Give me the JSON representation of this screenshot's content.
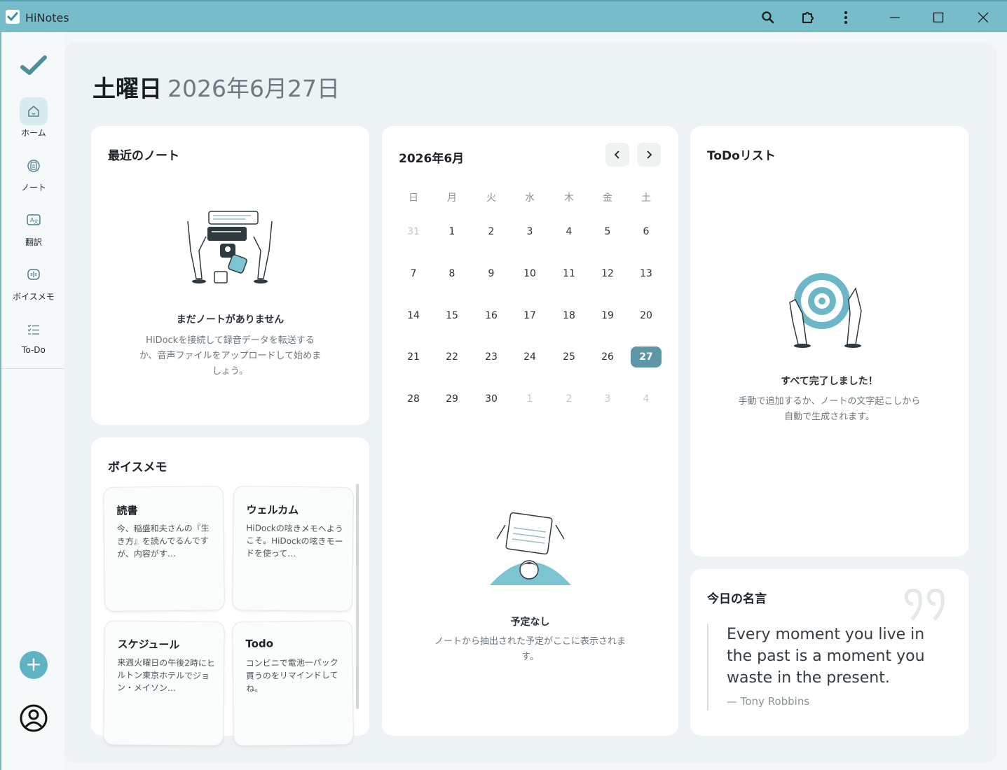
{
  "window": {
    "title": "HiNotes",
    "icons": [
      "search-icon",
      "extension-icon",
      "more-vertical-icon",
      "minimize-icon",
      "maximize-icon",
      "close-icon"
    ]
  },
  "sidebar": {
    "items": [
      {
        "label": "ホーム",
        "icon": "home-icon"
      },
      {
        "label": "ノート",
        "icon": "notes-icon"
      },
      {
        "label": "翻訳",
        "icon": "translate-icon"
      },
      {
        "label": "ボイスメモ",
        "icon": "voice-memo-icon"
      },
      {
        "label": "To-Do",
        "icon": "todo-list-icon"
      }
    ],
    "add_label": "+"
  },
  "header": {
    "weekday": "土曜日",
    "date": "2026年6月27日"
  },
  "recent_notes": {
    "title": "最近のノート",
    "empty_title": "まだノートがありません",
    "empty_desc_1": "HiDockを接続して録音データを転送する",
    "empty_desc_2": "か、音声ファイルをアップロードして始めま",
    "empty_desc_3": "しょう。"
  },
  "calendar": {
    "month": "2026年6月",
    "weekdays": [
      "日",
      "月",
      "火",
      "水",
      "木",
      "金",
      "土"
    ],
    "weeks": [
      [
        "31",
        "1",
        "2",
        "3",
        "4",
        "5",
        "6"
      ],
      [
        "7",
        "8",
        "9",
        "10",
        "11",
        "12",
        "13"
      ],
      [
        "14",
        "15",
        "16",
        "17",
        "18",
        "19",
        "20"
      ],
      [
        "21",
        "22",
        "23",
        "24",
        "25",
        "26",
        "27"
      ],
      [
        "28",
        "29",
        "30",
        "1",
        "2",
        "3",
        "4"
      ]
    ],
    "selected_day": "27",
    "empty_title": "予定なし",
    "empty_desc_1": "ノートから抽出された予定がここに表示されま",
    "empty_desc_2": "す。"
  },
  "todo": {
    "title": "ToDoリスト",
    "empty_title": "すべて完了しました！",
    "empty_desc_1": "手動で追加するか、ノートの文字起こしから",
    "empty_desc_2": "自動で生成されます。"
  },
  "voice_memos": {
    "title": "ボイスメモ",
    "items": [
      {
        "title": "読書",
        "body": "今、稲盛和夫さんの『生き方』を読んでるんですが、内容がす…"
      },
      {
        "title": "ウェルカム",
        "body": "HiDockの呟きメモへようこそ。HiDockの呟きモードを使って…"
      },
      {
        "title": "スケジュール",
        "body": "来週火曜日の午後2時にヒルトン東京ホテルでジョン・メイソン…"
      },
      {
        "title": "Todo",
        "body": "コンビニで電池一パック買うのをリマインドしてね。"
      }
    ]
  },
  "quote": {
    "title": "今日の名言",
    "text": "Every moment you live in the past is a moment you waste in the present.",
    "author": "— Tony Robbins"
  },
  "colors": {
    "titlebar": "#76bccb",
    "accent": "#5fb3c4",
    "today": "#5d97a6"
  }
}
